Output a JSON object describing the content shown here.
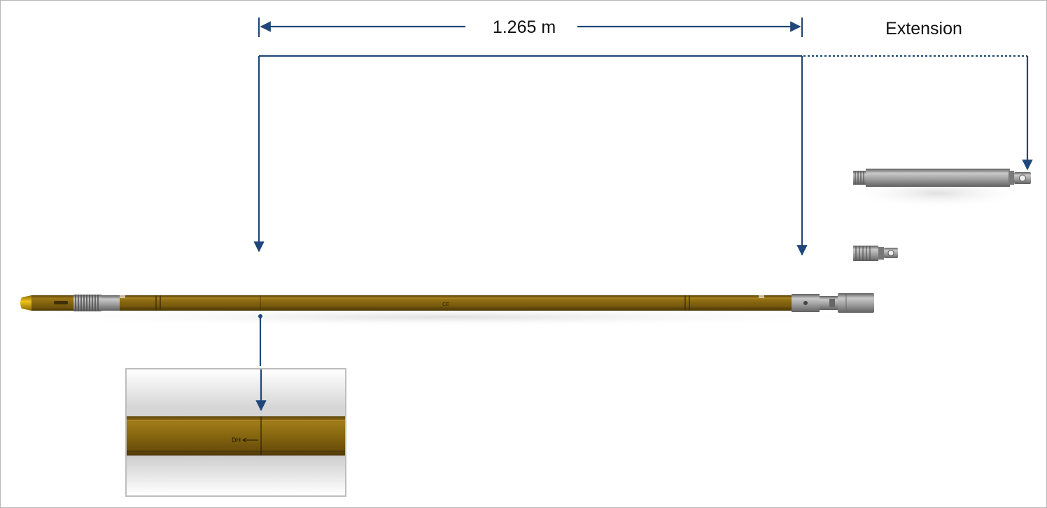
{
  "dimension": {
    "label": "1.265 m"
  },
  "extension": {
    "label": "Extension"
  },
  "probe": {
    "mark_ce": "CE"
  },
  "inset": {
    "mark_text": "DH"
  },
  "colors": {
    "arrow": "#1f4779",
    "probe_body": "#8a6a12",
    "probe_dark": "#5a4208",
    "steel": "#9a9a9a",
    "frame_border": "#b8b8b8"
  }
}
